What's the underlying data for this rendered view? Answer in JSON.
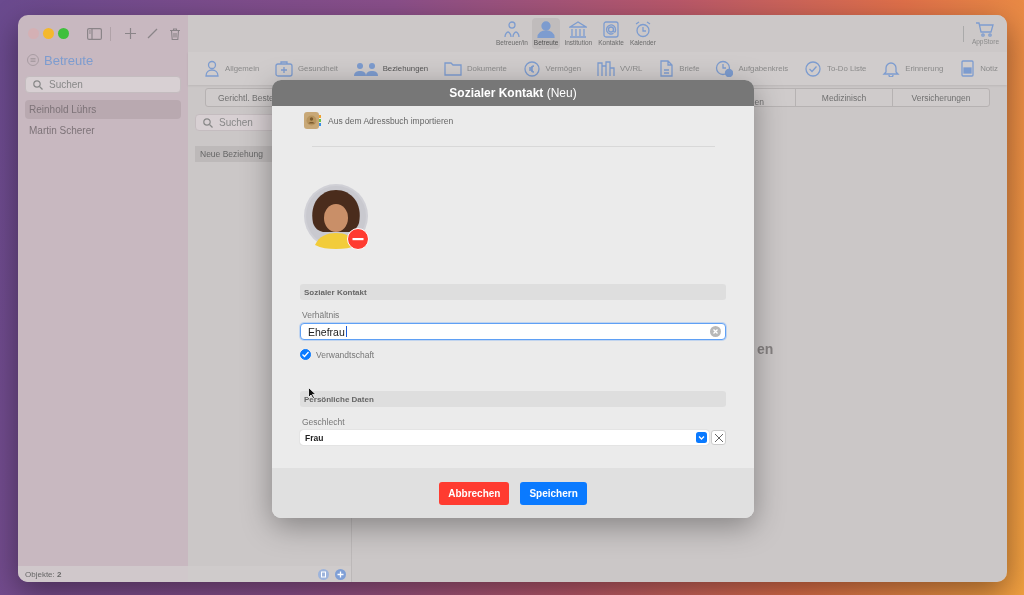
{
  "sidebar": {
    "title": "Betreute",
    "search": {
      "placeholder": "Suchen"
    },
    "items": [
      {
        "label": "Reinhold Lührs",
        "selected": true
      },
      {
        "label": "Martin Scherer",
        "selected": false
      }
    ],
    "status": "Objekte: **2**"
  },
  "toolbar": {
    "items": [
      {
        "label": "Betreuer/in",
        "selected": false
      },
      {
        "label": "Betreute",
        "selected": true
      },
      {
        "label": "Institution",
        "selected": false
      },
      {
        "label": "Kontakte",
        "selected": false
      },
      {
        "label": "Kalender",
        "selected": false
      }
    ],
    "store": {
      "label": "AppStore"
    }
  },
  "tabs": [
    {
      "label": "Allgemein",
      "selected": false
    },
    {
      "label": "Gesundheit",
      "selected": false
    },
    {
      "label": "Beziehungen",
      "selected": true
    },
    {
      "label": "Dokumente",
      "selected": false
    },
    {
      "label": "Vermögen",
      "selected": false
    },
    {
      "label": "VV/RL",
      "selected": false
    },
    {
      "label": "Briefe",
      "selected": false
    },
    {
      "label": "Aufgabenkreis",
      "selected": false
    },
    {
      "label": "To-Do Liste",
      "selected": false
    },
    {
      "label": "Erinnerung",
      "selected": false
    },
    {
      "label": "Notiz",
      "selected": false
    }
  ],
  "segments": [
    {
      "label": "Gerichtl. Beste"
    },
    {
      "label": "en"
    },
    {
      "label": "Medizinisch"
    },
    {
      "label": "Versicherungen"
    }
  ],
  "list": {
    "search": {
      "placeholder": "Suchen"
    },
    "items": [
      {
        "label": "Neue Beziehung"
      }
    ]
  },
  "content": {
    "empty_text": "en"
  },
  "dialog": {
    "title": "**Sozialer Kontakt** (Neu)",
    "import_link": "Aus dem Adressbuch importieren",
    "sections": [
      {
        "title": "Sozialer Kontakt",
        "fields": [
          {
            "kind": "text",
            "label": "Verhältnis",
            "value": "Ehefrau"
          },
          {
            "kind": "checkbox",
            "label": "Verwandtschaft",
            "checked": true
          }
        ]
      },
      {
        "title": "Persönliche Daten",
        "fields": [
          {
            "kind": "select",
            "label": "Geschlecht",
            "value": "Frau"
          }
        ]
      }
    ],
    "buttons": [
      {
        "label": "Abbrechen",
        "kind": "cancel"
      },
      {
        "label": "Speichern",
        "kind": "primary"
      }
    ]
  }
}
